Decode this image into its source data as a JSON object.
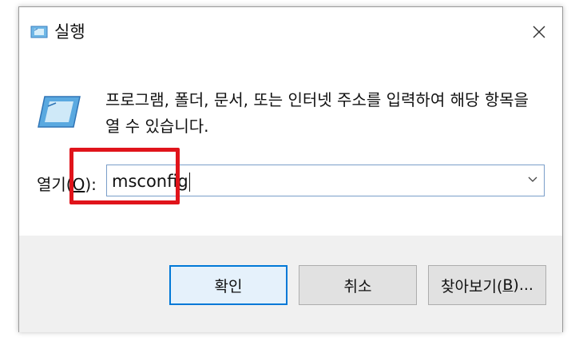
{
  "window": {
    "title": "실행"
  },
  "description": "프로그램, 폴더, 문서, 또는 인터넷 주소를 입력하여 해당 항목을 열 수 있습니다.",
  "open_field": {
    "label_prefix": "열기(",
    "label_accel": "O",
    "label_suffix": "):",
    "value": "msconfig"
  },
  "buttons": {
    "ok": "확인",
    "cancel": "취소",
    "browse_prefix": "찾아보기(",
    "browse_accel": "B",
    "browse_suffix": ")..."
  },
  "icons": {
    "title": "run-icon",
    "dialog": "run-icon",
    "close": "close-icon",
    "dropdown": "chevron-down-icon"
  },
  "colors": {
    "highlight": "#e0141b",
    "default_button_border": "#0078d7",
    "input_border": "#7a9ec9"
  }
}
